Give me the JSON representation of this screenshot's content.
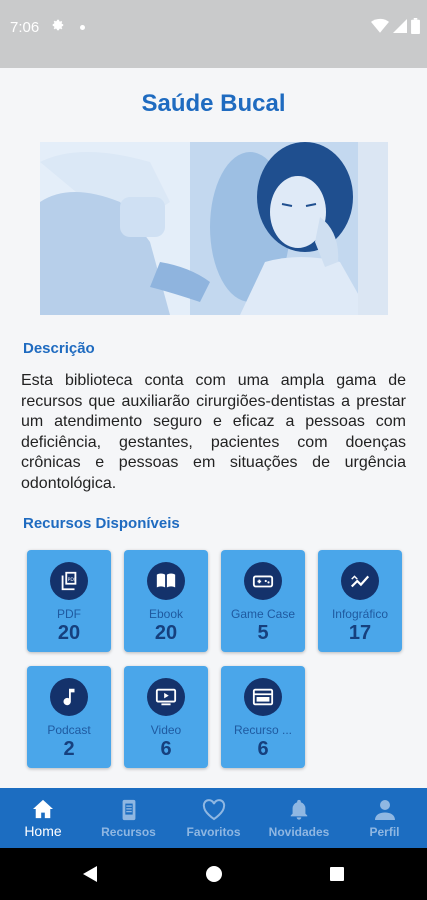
{
  "status": {
    "time": "7:06"
  },
  "page": {
    "title": "Saúde Bucal"
  },
  "description": {
    "heading": "Descrição",
    "text": "Esta biblioteca conta com uma ampla gama de recursos que auxiliarão cirurgiões-dentistas a prestar um atendimento seguro e eficaz a pessoas com deficiência, gestantes, pacientes com doenças crônicas e pessoas em situações de urgência odontológica."
  },
  "resources": {
    "heading": "Recursos Disponíveis",
    "items": [
      {
        "label": "PDF",
        "count": "20",
        "icon": "pdf-icon"
      },
      {
        "label": "Ebook",
        "count": "20",
        "icon": "book-icon"
      },
      {
        "label": "Game Case",
        "count": "5",
        "icon": "gamepad-icon"
      },
      {
        "label": "Infográfico",
        "count": "17",
        "icon": "chart-icon"
      },
      {
        "label": "Podcast",
        "count": "2",
        "icon": "music-note-icon"
      },
      {
        "label": "Video",
        "count": "6",
        "icon": "video-icon"
      },
      {
        "label": "Recurso ...",
        "count": "6",
        "icon": "web-icon"
      }
    ]
  },
  "bottom_nav": {
    "items": [
      {
        "label": "Home",
        "icon": "home-icon",
        "active": true
      },
      {
        "label": "Recursos",
        "icon": "phone-icon"
      },
      {
        "label": "Favoritos",
        "icon": "heart-icon"
      },
      {
        "label": "Novidades",
        "icon": "bell-icon"
      },
      {
        "label": "Perfil",
        "icon": "person-icon"
      }
    ]
  },
  "colors": {
    "primary": "#1c6dc1",
    "card": "#4aa6ea",
    "icon_circle": "#14326b",
    "heading": "#1f6bc0"
  }
}
